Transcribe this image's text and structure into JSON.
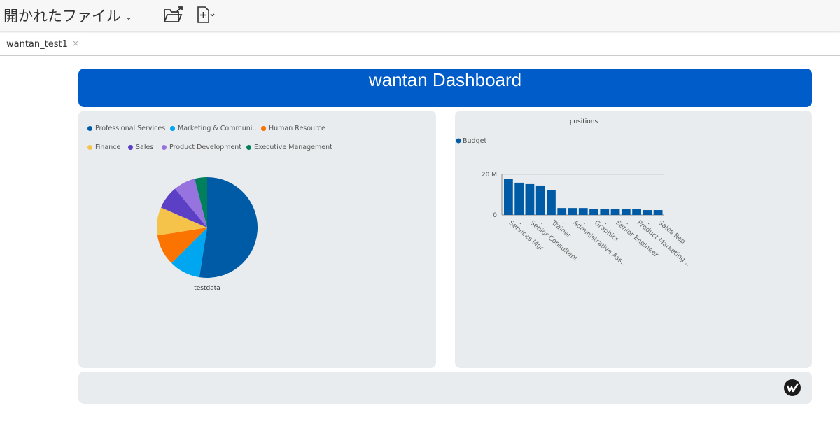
{
  "toolbar": {
    "menu_title": "開かれたファイル",
    "icons": [
      "chevron-down-icon",
      "open-folder-icon",
      "new-file-icon"
    ]
  },
  "tabs": [
    {
      "label": "wantan_test1",
      "close": "×"
    }
  ],
  "header": {
    "title": "wantan Dashboard",
    "color": "#005cc8"
  },
  "chart_data": [
    {
      "type": "pie",
      "xlabel": "testdata",
      "categories": [
        "Professional Services",
        "Marketing & Communi..",
        "Human Resource",
        "Finance",
        "Sales",
        "Product Development",
        "Executive Management"
      ],
      "values": [
        52.5,
        10,
        10,
        9,
        7.5,
        7,
        4
      ],
      "colors": [
        "#005ba6",
        "#00a6f0",
        "#fb7300",
        "#f5c34a",
        "#5b3fc5",
        "#9673df",
        "#00805a"
      ],
      "legend": "top"
    },
    {
      "type": "bar",
      "title": "positions",
      "legend": "top-left",
      "series": [
        {
          "name": "Budget",
          "color": "#005ba6",
          "values": [
            17.6,
            15.9,
            15.2,
            14.5,
            12.4,
            3.4,
            3.4,
            3.4,
            3.1,
            3.1,
            3.1,
            2.8,
            2.8,
            2.4,
            2.4
          ]
        }
      ],
      "categories": [
        "Services Mgr",
        ".",
        "Senior Consultant",
        ".",
        "Trainer",
        ".",
        "Administrative Ass..",
        ".",
        "Graphics",
        ".",
        "Senior Engineer",
        ".",
        "Product Marketing ..",
        ".",
        "Sales Rep"
      ],
      "yticks": [
        {
          "value": 0,
          "label": "0"
        },
        {
          "value": 20,
          "label": "20 M"
        }
      ],
      "ylim": [
        0,
        20
      ],
      "grid": true
    }
  ],
  "footer": {
    "logo": "W"
  }
}
